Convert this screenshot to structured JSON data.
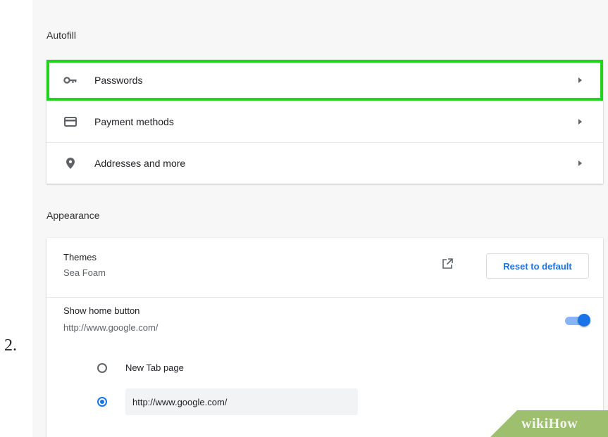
{
  "step": {
    "number": "2."
  },
  "autofill": {
    "title": "Autofill",
    "items": [
      {
        "label": "Passwords",
        "icon": "key-icon",
        "highlighted": true
      },
      {
        "label": "Payment methods",
        "icon": "credit-card-icon",
        "highlighted": false
      },
      {
        "label": "Addresses and more",
        "icon": "location-pin-icon",
        "highlighted": false
      }
    ]
  },
  "appearance": {
    "title": "Appearance",
    "themes": {
      "label": "Themes",
      "value": "Sea Foam",
      "reset_label": "Reset to default"
    },
    "home_button": {
      "label": "Show home button",
      "url": "http://www.google.com/",
      "enabled": true
    },
    "radio_options": {
      "new_tab_label": "New Tab page",
      "custom_url": "http://www.google.com/",
      "selected": "custom"
    }
  },
  "watermark": {
    "text": "wikiHow"
  },
  "colors": {
    "highlight": "#22d31c",
    "accent": "#1a73e8",
    "watermark": "#9ebf6e"
  }
}
